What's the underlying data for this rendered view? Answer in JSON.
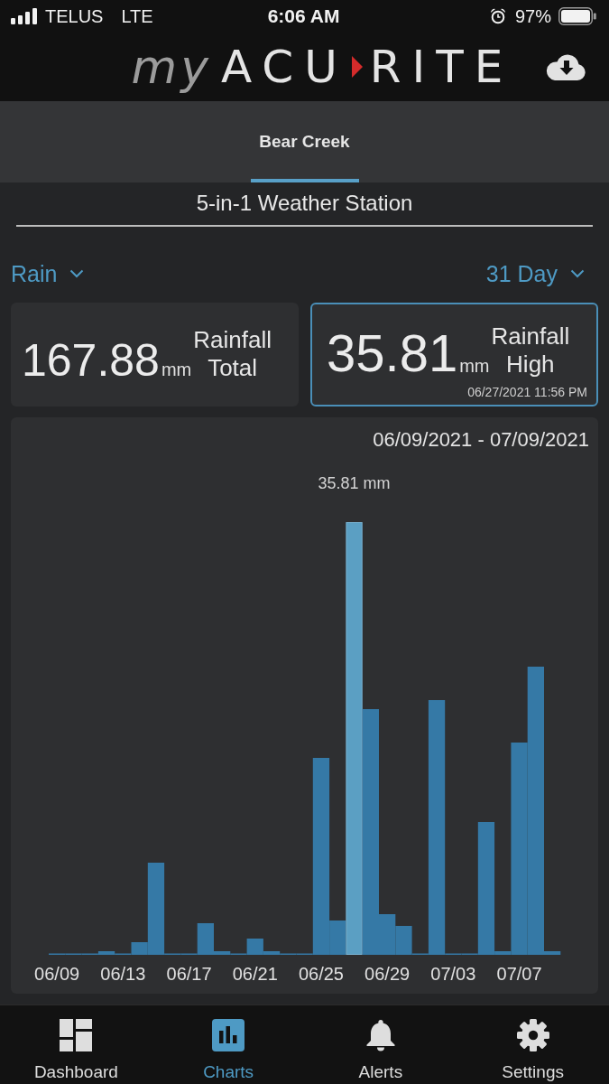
{
  "status_bar": {
    "carrier": "TELUS",
    "network": "LTE",
    "time": "6:06 AM",
    "battery": "97%"
  },
  "header": {
    "logo": {
      "prefix": "my",
      "name_start": "ACU",
      "name_end": "RITE"
    }
  },
  "tabs": [
    {
      "label": "Bear Creek",
      "selected": true
    }
  ],
  "station": {
    "title": "5-in-1 Weather Station"
  },
  "selectors": {
    "measure": "Rain",
    "period": "31 Day"
  },
  "summary_cards": [
    {
      "value": "167.88",
      "unit": "mm",
      "label": "Rainfall Total",
      "selected": false
    },
    {
      "value": "35.81",
      "unit": "mm",
      "label": "Rainfall High",
      "timestamp": "06/27/2021 11:56 PM",
      "selected": true
    }
  ],
  "chart": {
    "date_range": "06/09/2021 - 07/09/2021",
    "peak_label": "35.81 mm",
    "x_labels": [
      "06/09",
      "06/13",
      "06/17",
      "06/21",
      "06/25",
      "06/29",
      "07/03",
      "07/07"
    ]
  },
  "bottom_nav": [
    {
      "label": "Dashboard",
      "selected": false
    },
    {
      "label": "Charts",
      "selected": true
    },
    {
      "label": "Alerts",
      "selected": false
    },
    {
      "label": "Settings",
      "selected": false
    }
  ]
}
